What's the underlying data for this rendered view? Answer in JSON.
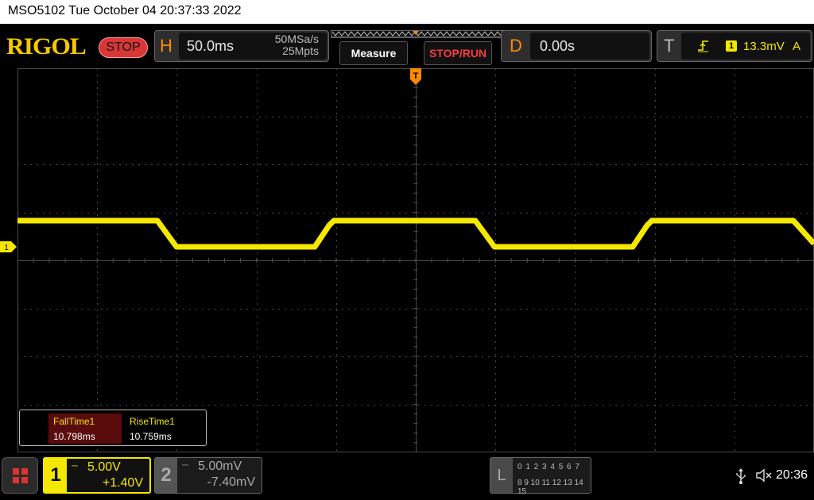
{
  "title_bar": {
    "text": "MSO5102  Tue October 04 20:37:33 2022"
  },
  "header": {
    "logo": "RIGOL",
    "run_state": "STOP",
    "horizontal": {
      "letter": "H",
      "timebase": "50.0ms",
      "sample_rate": "50MSa/s",
      "memory_depth": "25Mpts"
    },
    "measure_label": "Measure",
    "stoprun_label": "STOP/RUN",
    "delay": {
      "letter": "D",
      "value": "0.00s"
    },
    "trigger": {
      "letter": "T",
      "source_channel": "1",
      "level": "13.3mV",
      "mode": "A"
    }
  },
  "measurements": [
    {
      "label": "FallTime1",
      "value": "10.798ms"
    },
    {
      "label": "RiseTime1",
      "value": "10.759ms"
    }
  ],
  "channel_marker": "1",
  "channels": [
    {
      "number": "1",
      "scale": "5.00V",
      "offset": "+1.40V",
      "active": true,
      "color": "#f5e800"
    },
    {
      "number": "2",
      "scale": "5.00mV",
      "offset": "-7.40mV",
      "active": false,
      "color": "#aaaaaa"
    }
  ],
  "logic": {
    "letter": "L",
    "row1": "0 1 2 3  4 5 6 7",
    "row2": "8 9 10 11 12 13 14 15"
  },
  "status": {
    "time": "20:36",
    "icons": [
      "usb-icon",
      "speaker-muted-icon"
    ]
  },
  "colors": {
    "trace": "#f5e800",
    "accent": "#ff8a00",
    "stop_red": "#d93636",
    "grid": "#4a4a4a"
  }
}
